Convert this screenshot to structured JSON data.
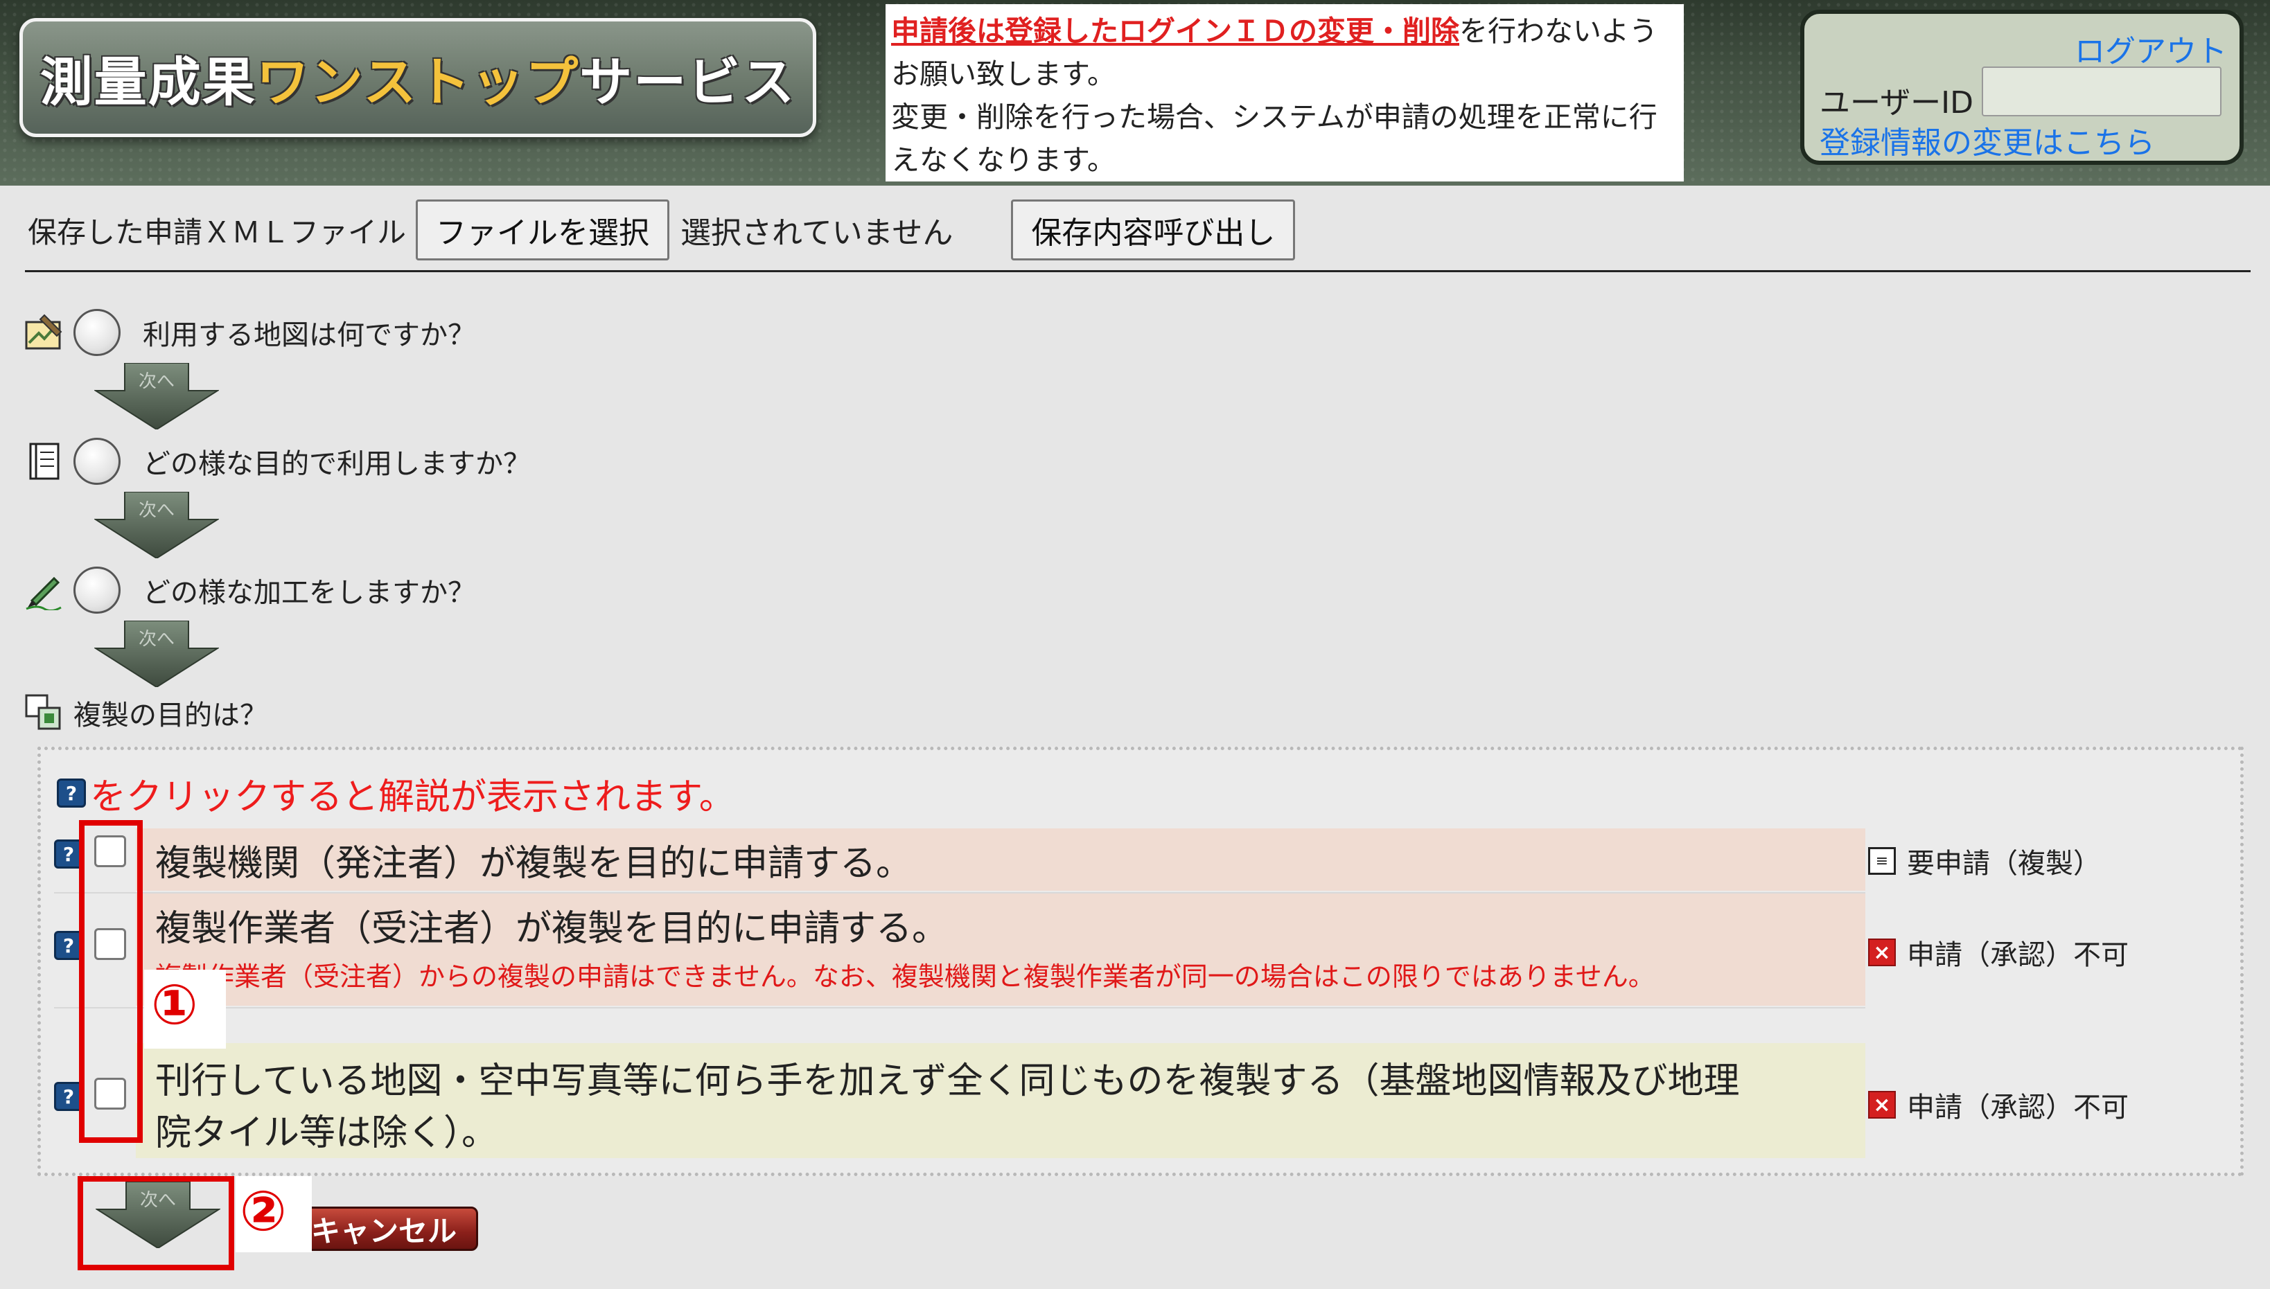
{
  "header": {
    "logo_part1": "測量成果",
    "logo_part2": "ワンストップ",
    "logo_part3": "サービス",
    "notice_red": "申請後は登録したログインＩＤの変更・削除",
    "notice_rest1": "を行わないよう",
    "notice_line2": "お願い致します。",
    "notice_line3": "変更・削除を行った場合、システムが申請の処理を正常に行",
    "notice_line4": "えなくなります。",
    "logout": "ログアウト",
    "userid_label": "ユーザーID",
    "userid_value": "",
    "profile_link": "登録情報の変更はこちら"
  },
  "file_bar": {
    "label": "保存した申請ＸＭＬファイル",
    "choose_button": "ファイルを選択",
    "no_file": "選択されていません",
    "load_button": "保存内容呼び出し"
  },
  "steps": [
    {
      "icon": "map-edit-icon",
      "text": "利用する地図は何ですか？"
    },
    {
      "icon": "notebook-icon",
      "text": "どの様な目的で利用しますか？"
    },
    {
      "icon": "pencil-icon",
      "text": "どの様な加工をしますか？"
    }
  ],
  "next_label": "次へ",
  "section": {
    "title": "複製の目的は？",
    "hint": "をクリックすると解説が表示されます。",
    "options": [
      {
        "text": "複製機関（発注者）が複製を目的に申請する。",
        "note": "",
        "status": "要申請（複製）",
        "status_icon": "document-icon",
        "bg": "#f0dcd2"
      },
      {
        "text": "複製作業者（受注者）が複製を目的に申請する。",
        "note": "複製作業者（受注者）からの複製の申請はできません。なお、複製機関と複製作業者が同一の場合はこの限りではありません。",
        "status": "申請（承認）不可",
        "status_icon": "x-icon",
        "bg": "#f0dcd2"
      },
      {
        "text": "刊行している地図・空中写真等に何ら手を加えず全く同じものを複製する（基盤地図情報及び地理",
        "text2": "院タイル等は除く）。",
        "note": "",
        "status": "申請（承認）不可",
        "status_icon": "x-icon",
        "bg": "#ececd2"
      }
    ]
  },
  "cancel_button": "キャンセル",
  "annotations": [
    "①",
    "②"
  ],
  "colors": {
    "accent_red": "#e00000",
    "link_blue": "#1a73e8",
    "logo_yellow": "#f4c23c"
  }
}
